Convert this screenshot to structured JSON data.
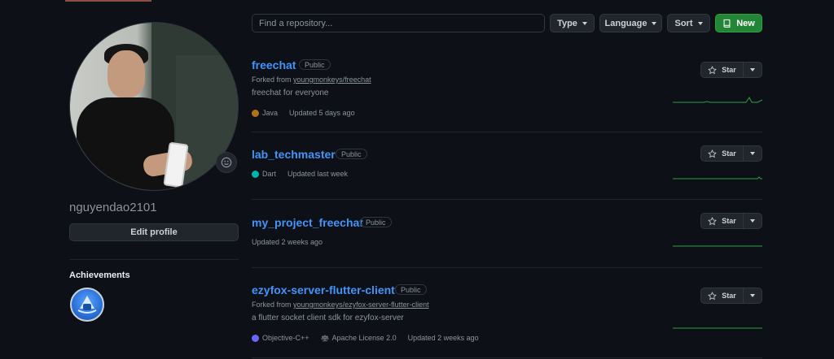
{
  "sidebar": {
    "username": "nguyendao2101",
    "edit_profile": "Edit profile",
    "achievements_title": "Achievements"
  },
  "filters": {
    "search_placeholder": "Find a repository...",
    "type": "Type",
    "language": "Language",
    "sort": "Sort",
    "new": "New"
  },
  "colors": {
    "link": "#4493f8",
    "new_button": "#238636",
    "java": "#b07219",
    "dart": "#00B4AB",
    "objective_cpp": "#6866fb",
    "spark": "#2ea043"
  },
  "repos": [
    {
      "name": "freechat",
      "visibility": "Public",
      "forked_prefix": "Forked from",
      "forked_from": "youngmonkeys/freechat",
      "description": "freechat for everyone",
      "language": "Java",
      "license": "",
      "updated": "Updated 5 days ago",
      "star_label": "Star"
    },
    {
      "name": "lab_techmaster",
      "visibility": "Public",
      "forked_prefix": "",
      "forked_from": "",
      "description": "",
      "language": "Dart",
      "license": "",
      "updated": "Updated last week",
      "star_label": "Star"
    },
    {
      "name": "my_project_freechat",
      "visibility": "Public",
      "forked_prefix": "",
      "forked_from": "",
      "description": "",
      "language": "",
      "license": "",
      "updated": "Updated 2 weeks ago",
      "star_label": "Star"
    },
    {
      "name": "ezyfox-server-flutter-client",
      "visibility": "Public",
      "forked_prefix": "Forked from",
      "forked_from": "youngmonkeys/ezyfox-server-flutter-client",
      "description": "a flutter socket client sdk for ezyfox-server",
      "language": "Objective-C++",
      "license": "Apache License 2.0",
      "updated": "Updated 2 weeks ago",
      "star_label": "Star"
    }
  ]
}
